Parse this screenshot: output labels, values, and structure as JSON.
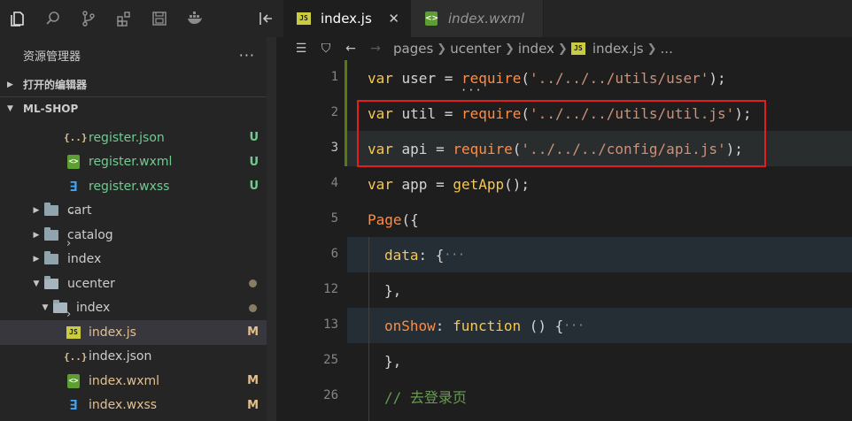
{
  "activity": {
    "icons": [
      "files-icon",
      "search-icon",
      "source-control-icon",
      "extensions-icon",
      "remote-icon",
      "docker-icon",
      "collapse-icon"
    ]
  },
  "sidebar": {
    "title": "资源管理器",
    "more": "···",
    "open_editors": "打开的编辑器",
    "project": "ML-SHOP",
    "items": [
      {
        "label": "register.json",
        "icon": "{..}",
        "badge": "U"
      },
      {
        "label": "register.wxml",
        "icon": "wx",
        "badge": "U"
      },
      {
        "label": "register.wxss",
        "icon": "3",
        "badge": "U"
      },
      {
        "label": "cart"
      },
      {
        "label": "catalog"
      },
      {
        "label": "index"
      },
      {
        "label": "ucenter"
      },
      {
        "label": "index"
      },
      {
        "label": "index.js",
        "icon": "JS",
        "badge": "M"
      },
      {
        "label": "index.json",
        "icon": "{..}"
      },
      {
        "label": "index.wxml",
        "icon": "wx",
        "badge": "M"
      },
      {
        "label": "index.wxss",
        "icon": "3",
        "badge": "M"
      }
    ]
  },
  "tabs": [
    {
      "label": "index.js",
      "close": "✕"
    },
    {
      "label": "index.wxml"
    }
  ],
  "breadcrumb": {
    "back": "←",
    "forward": "→",
    "parts": [
      "pages",
      "ucenter",
      "index",
      "index.js",
      "..."
    ]
  },
  "gutter": {
    "lines": [
      "1",
      "2",
      "3",
      "4",
      "5",
      "6",
      "12",
      "13",
      "25",
      "26"
    ]
  },
  "code": {
    "l1": {
      "kw": "var",
      "name": " user = ",
      "fn": "require",
      "p1": "(",
      "str": "'../../../utils/user'",
      "p2": ");"
    },
    "l2": {
      "kw": "var",
      "name": " util = ",
      "fn": "require",
      "p1": "(",
      "str": "'../../../utils/util.js'",
      "p2": ");"
    },
    "l3": {
      "kw": "var",
      "name": " api = ",
      "fn": "require",
      "p1": "(",
      "str": "'../../../config/api.js'",
      "p2": ");"
    },
    "l4": {
      "kw": "var",
      "name": " app = ",
      "fn": "getApp",
      "p": "();"
    },
    "l5": {
      "fn": "Page",
      "p": "({"
    },
    "l6": {
      "prop": "data",
      "p": ": {",
      "fold": "···"
    },
    "l12": {
      "p": "},"
    },
    "l13": {
      "prop": "onShow",
      "p": ": ",
      "kw": "function",
      "p2": " () {",
      "fold": "···"
    },
    "l25": {
      "p": "},"
    },
    "l26": {
      "cmt": "// 去登录页"
    },
    "dots": "···"
  }
}
